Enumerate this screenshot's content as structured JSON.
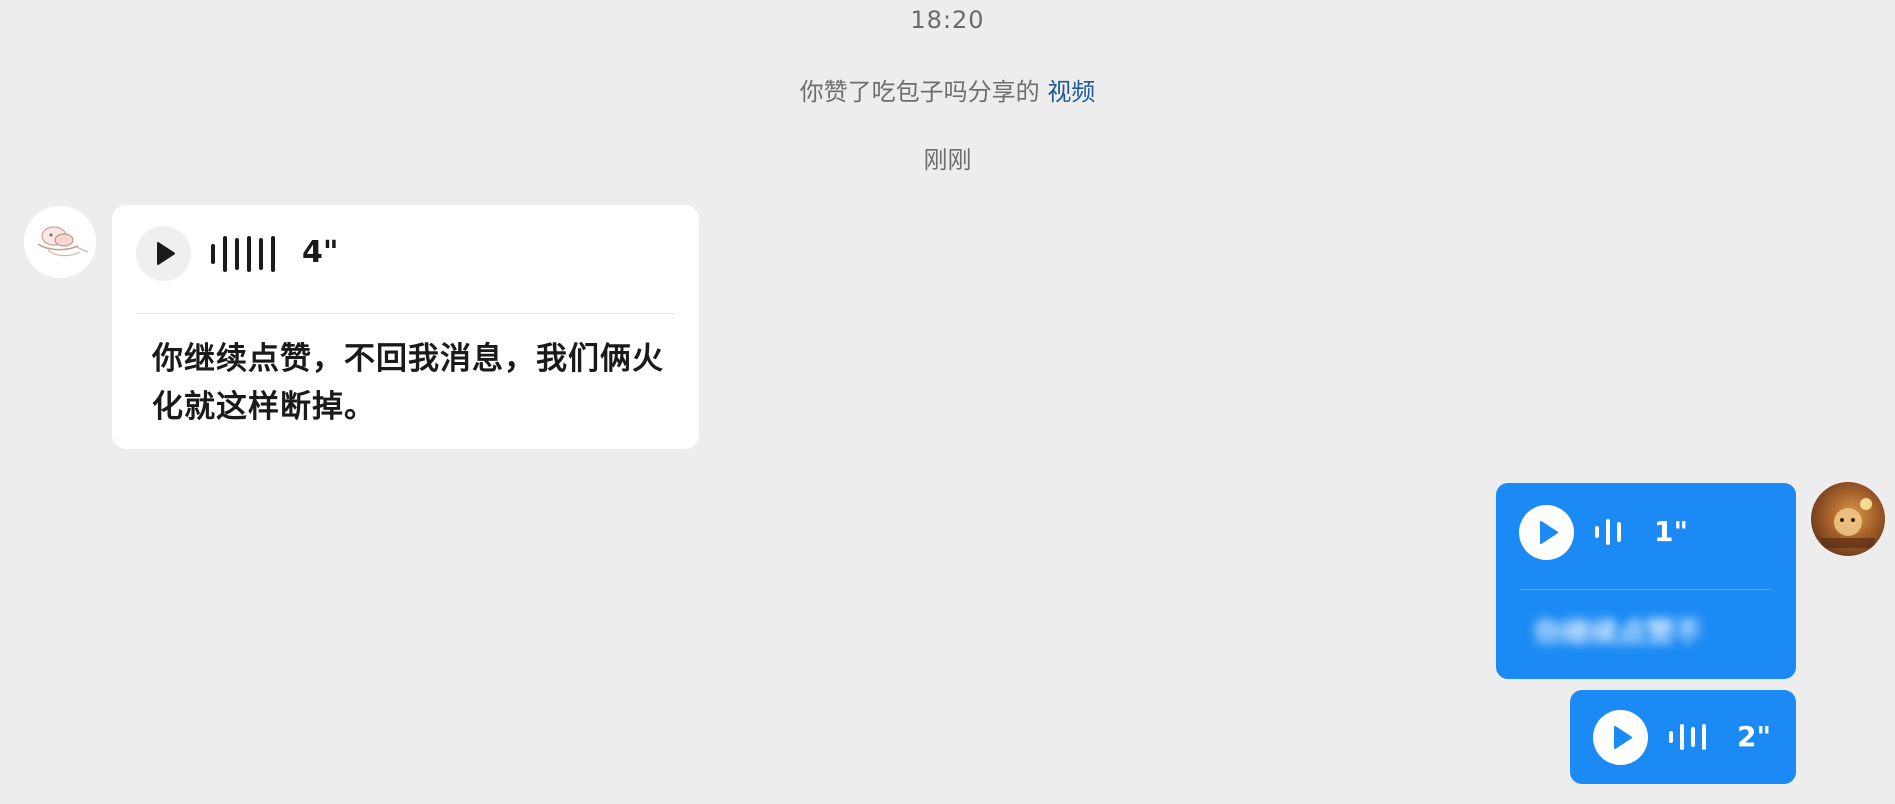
{
  "chat": {
    "timestamp": "18:20",
    "system_notice": {
      "prefix": "你赞了吃包子吗分享的 ",
      "link_text": "视频"
    },
    "relative_time": "刚刚"
  },
  "incoming": {
    "voice_duration": "4\"",
    "transcript": "你继续点赞，不回我消息，我们俩火化就这样断掉。"
  },
  "outgoing": [
    {
      "voice_duration": "1\"",
      "transcript_blurred": "你继续点赞不"
    },
    {
      "voice_duration": "2\""
    }
  ],
  "colors": {
    "background": "#ededed",
    "incoming_bubble": "#ffffff",
    "outgoing_bubble": "#1b8af4",
    "link": "#1f5a96"
  },
  "icons": {
    "play": "play-icon",
    "waveform": "waveform-icon"
  }
}
